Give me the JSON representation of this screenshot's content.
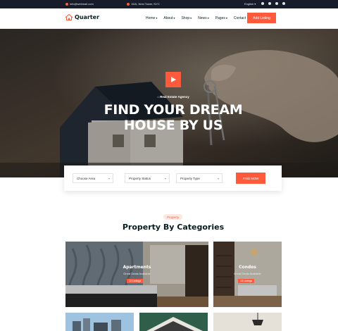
{
  "topbar": {
    "email": "info@webmail.com",
    "address": "15/A, Nest Tower, NYC",
    "language": "English",
    "socials": [
      "facebook-icon",
      "twitter-icon",
      "instagram-icon",
      "dribbble-icon"
    ]
  },
  "header": {
    "logo_text": "Quarter",
    "nav": [
      "Home",
      "About",
      "Shop",
      "News",
      "Pages",
      "Contact"
    ],
    "cta_label": "Add Listing"
  },
  "hero": {
    "subtitle": "Real Estate Agency",
    "title_line1": "FIND YOUR DREAM",
    "title_line2": "HOUSE BY US"
  },
  "search": {
    "area_placeholder": "Choose Area",
    "status_placeholder": "Property Status",
    "type_placeholder": "Property Type",
    "button_label": "FIND NOW"
  },
  "categories": {
    "badge": "Property",
    "title": "Property By Categories",
    "cards": [
      {
        "title": "Apartments",
        "subtitle": "Great Deals Available",
        "listings": "13 Listings"
      },
      {
        "title": "Condos",
        "subtitle": "Great Deals Available",
        "listings": "13 Listings"
      }
    ]
  },
  "colors": {
    "accent": "#ff5a3c",
    "dark": "#171b2a",
    "text": "#071c1f"
  }
}
